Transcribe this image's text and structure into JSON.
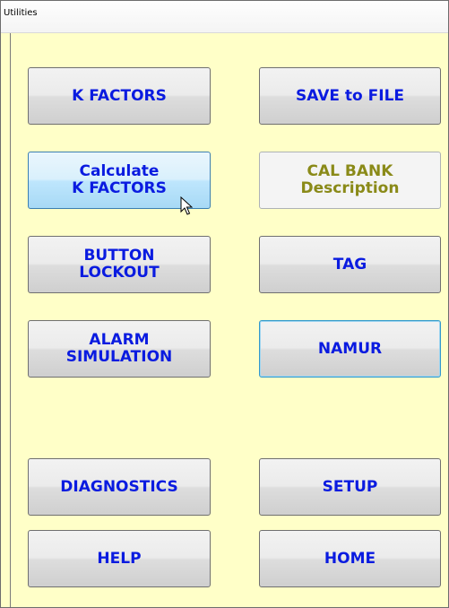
{
  "window": {
    "title": "Utilities"
  },
  "buttons": {
    "k_factors": "K FACTORS",
    "save_to_file": "SAVE to FILE",
    "calculate_k_factors": [
      "Calculate",
      "K FACTORS"
    ],
    "cal_bank_description": [
      "CAL BANK",
      "Description"
    ],
    "button_lockout": [
      "BUTTON",
      "LOCKOUT"
    ],
    "tag": "TAG",
    "alarm_simulation": [
      "ALARM",
      "SIMULATION"
    ],
    "namur": "NAMUR",
    "diagnostics": "DIAGNOSTICS",
    "setup": "SETUP",
    "help": "HELP",
    "home": "HOME"
  },
  "colors": {
    "background": "#ffffc8",
    "button_text": "#0a1be0",
    "disabled_text": "#8a8a18",
    "hover_fill": "#bee6fd"
  },
  "states": {
    "hovered_button": "calculate-k-factors-button",
    "disabled_button": "cal-bank-description-button",
    "focused_button": "namur-button"
  }
}
